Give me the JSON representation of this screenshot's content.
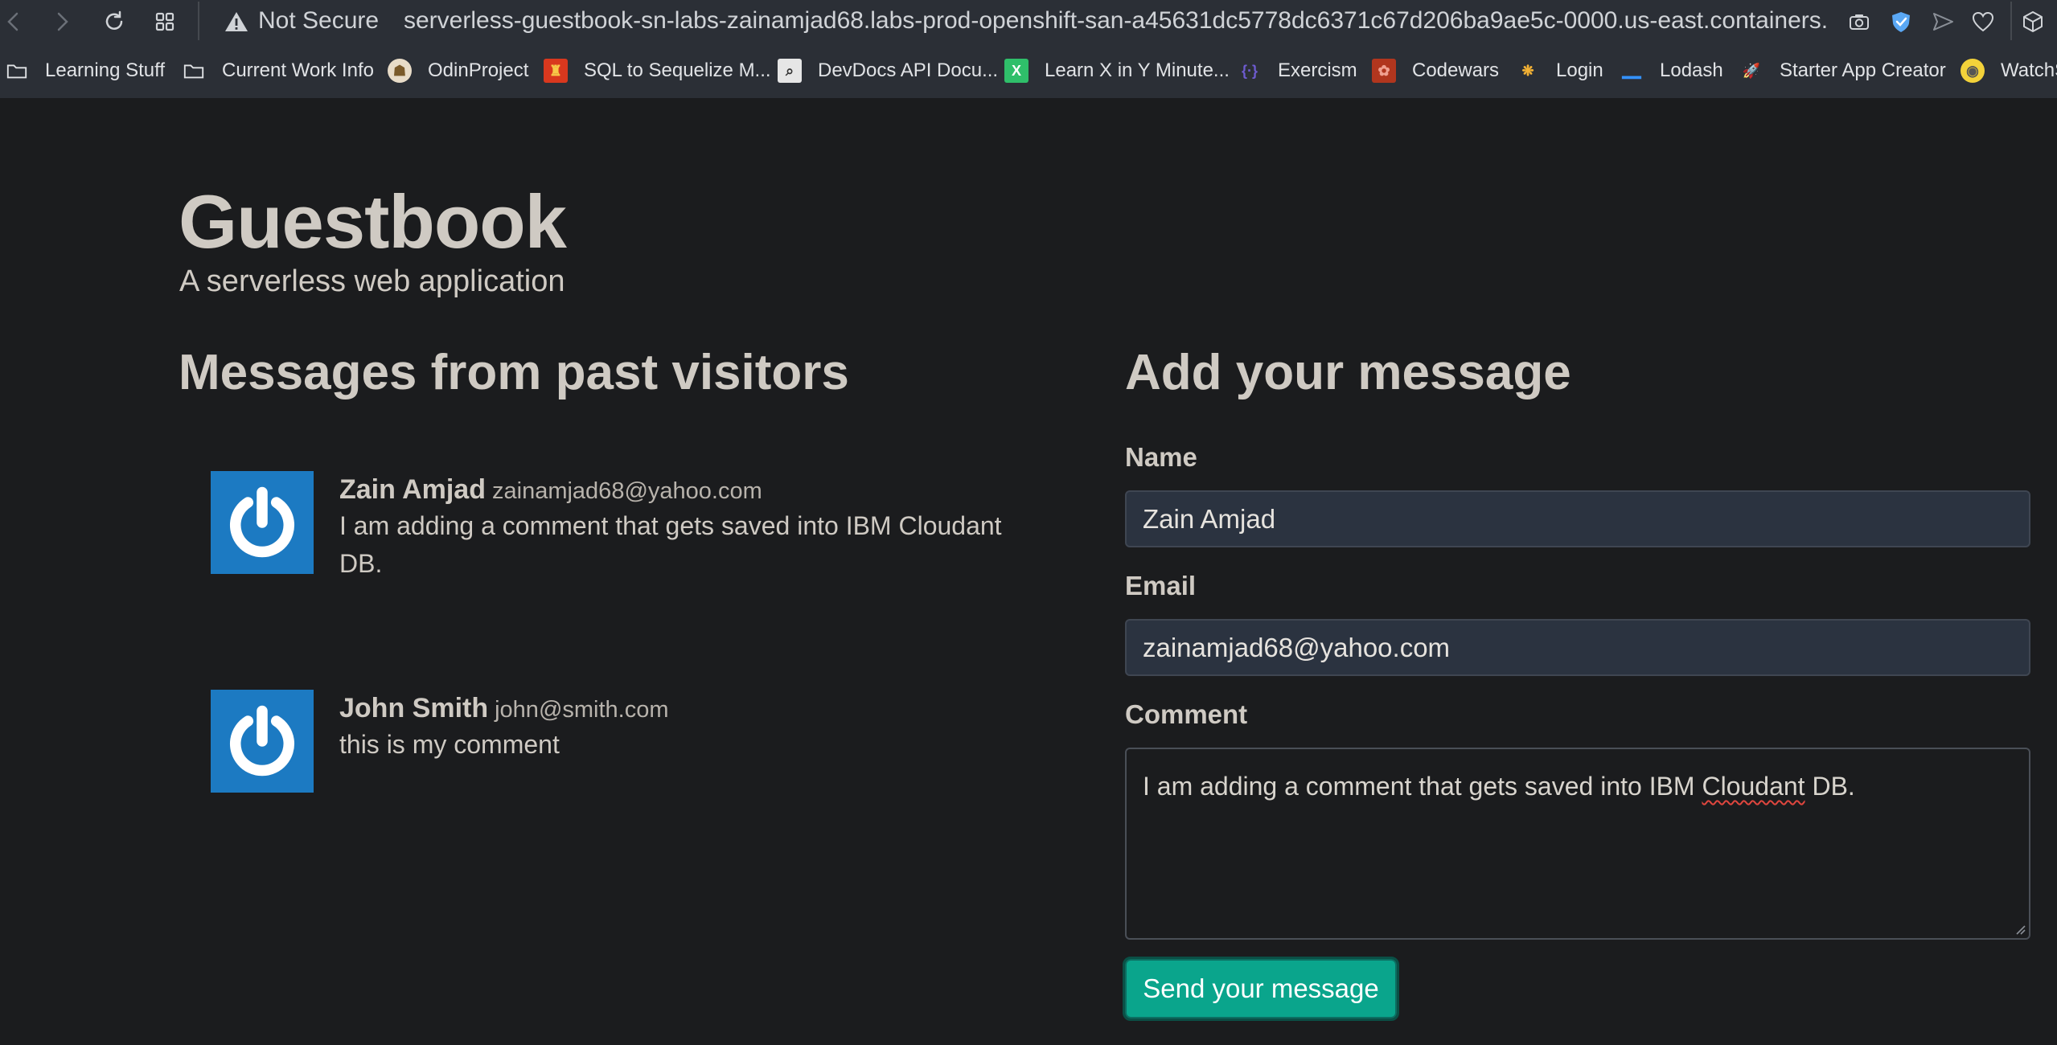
{
  "browser": {
    "security_label": "Not Secure",
    "url": "serverless-guestbook-sn-labs-zainamjad68.labs-prod-openshift-san-a45631dc5778dc6371c67d206ba9ae5c-0000.us-east.containers.appdomain.cloud",
    "icons": [
      "back-icon",
      "forward-icon",
      "reload-icon",
      "tabs-grid-icon",
      "warning-icon",
      "camera-icon",
      "shield-icon",
      "send-icon",
      "heart-icon",
      "cube-icon"
    ]
  },
  "bookmarks": [
    {
      "label": "Learning Stuff",
      "icon": "folder-icon"
    },
    {
      "label": "Current Work Info",
      "icon": "folder-icon"
    },
    {
      "label": "OdinProject",
      "icon": "odin-icon"
    },
    {
      "label": "SQL to Sequelize M...",
      "icon": "sql-icon"
    },
    {
      "label": "DevDocs API Docu...",
      "icon": "devdocs-icon"
    },
    {
      "label": "Learn X in Y Minute...",
      "icon": "learnx-icon"
    },
    {
      "label": "Exercism",
      "icon": "exercism-icon"
    },
    {
      "label": "Codewars",
      "icon": "codewars-icon"
    },
    {
      "label": "Login",
      "icon": "login-icon"
    },
    {
      "label": "Lodash",
      "icon": "lodash-icon"
    },
    {
      "label": "Starter App Creator",
      "icon": "rocket-icon"
    },
    {
      "label": "WatchS",
      "icon": "minion-icon"
    }
  ],
  "page": {
    "title": "Guestbook",
    "subtitle": "A serverless web application",
    "messages_heading": "Messages from past visitors",
    "form_heading": "Add your message"
  },
  "messages": [
    {
      "name": "Zain Amjad",
      "email": "zainamjad68@yahoo.com",
      "comment": "I am adding a comment that gets saved into IBM Cloudant DB."
    },
    {
      "name": "John Smith",
      "email": "john@smith.com",
      "comment": "this is my comment"
    }
  ],
  "form": {
    "name_label": "Name",
    "name_value": "Zain Amjad",
    "email_label": "Email",
    "email_value": "zainamjad68@yahoo.com",
    "comment_label": "Comment",
    "comment_before": "I am adding a comment that gets saved into IBM ",
    "comment_misspelled": "Cloudant",
    "comment_after": " DB.",
    "submit_label": "Send your message"
  },
  "colors": {
    "page_bg": "#1b1c1e",
    "chrome_bg": "#2b2f36",
    "avatar_bg": "#1c7ac2",
    "button_bg": "#0aa58c",
    "input_bg": "#2b3340",
    "text": "#cfcac3"
  }
}
